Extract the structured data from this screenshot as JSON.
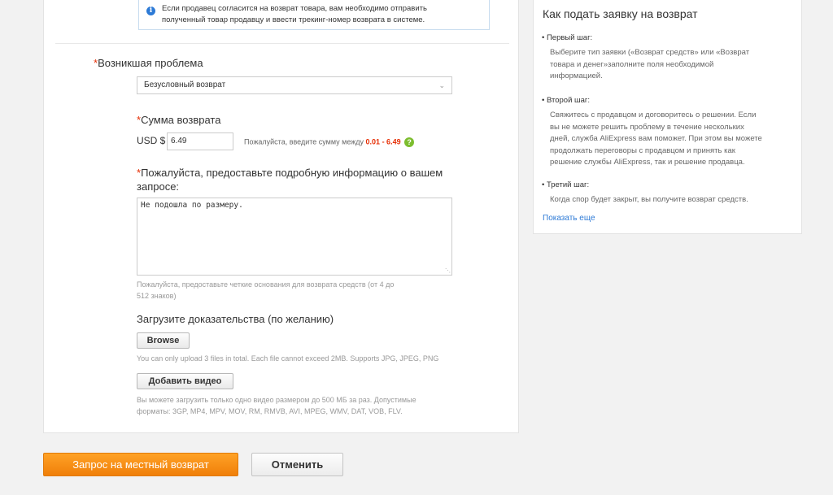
{
  "info": {
    "line1": "Если продавец согласится на возврат товара, вам необходимо отправить",
    "line2": "полученный товар продавцу и ввести трекинг-номер возврата в системе."
  },
  "form": {
    "required_mark": "*",
    "problem_label": "Возникшая проблема",
    "problem_value": "Безусловный возврат",
    "amount_label": "Сумма возврата",
    "currency": "USD $",
    "amount_value": "6.49",
    "amount_hint": "Пожалуйста, введите сумму между",
    "amount_range": "0.01 - 6.49",
    "details_label_line1": "Пожалуйста, предоставьте подробную информацию о вашем",
    "details_label_line2": "запросе:",
    "details_value": "Не подошла по размеру.",
    "details_hint_line1": "Пожалуйста, предоставьте четкие основания для возврата средств (от 4 до",
    "details_hint_line2": "512 знаков)",
    "upload_label": "Загрузите доказательства (по желанию)",
    "browse_label": "Browse",
    "upload_hint": "You can only upload 3 files in total. Each file cannot exceed 2MB. Supports JPG, JPEG, PNG",
    "add_video_label": "Добавить видео",
    "video_hint_line1": "Вы можете загрузить только одно видео размером до 500 МБ за раз. Допустимые",
    "video_hint_line2": "форматы: 3GP, MP4, MPV, MOV, RM, RMVB, AVI, MPEG, WMV, DAT, VOB, FLV."
  },
  "actions": {
    "submit_label": "Запрос на местный возврат",
    "cancel_label": "Отменить"
  },
  "sidebar": {
    "title": "Как подать заявку на возврат",
    "step1_title": "• Первый шаг:",
    "step1_l1": "Выберите тип заявки («Возврат средств» или «Возврат",
    "step1_l2": "товара и денег»заполните поля необходимой",
    "step1_l3": "информацией.",
    "step2_title": "• Второй шаг:",
    "step2_l1": "Свяжитесь с продавцом и договоритесь о решении. Если",
    "step2_l2": "вы не можете решить проблему в течение нескольких",
    "step2_l3": "дней, служба AliExpress вам поможет. При этом вы можете",
    "step2_l4": "продолжать переговоры с продавцом и принять как",
    "step2_l5": "решение службы AliExpress, так и решение продавца.",
    "step3_title": "• Третий шаг:",
    "step3_l1": "Когда спор будет закрыт, вы получите возврат средств.",
    "show_more": "Показать еще"
  },
  "colors": {
    "accent_orange": "#f5901a",
    "required_red": "#e62e04",
    "link_blue": "#2d7ad6",
    "help_green": "#7cbd2e"
  },
  "icons": {
    "info": "info-icon",
    "help": "help-icon",
    "select_arrow": "chevron-down-icon"
  }
}
